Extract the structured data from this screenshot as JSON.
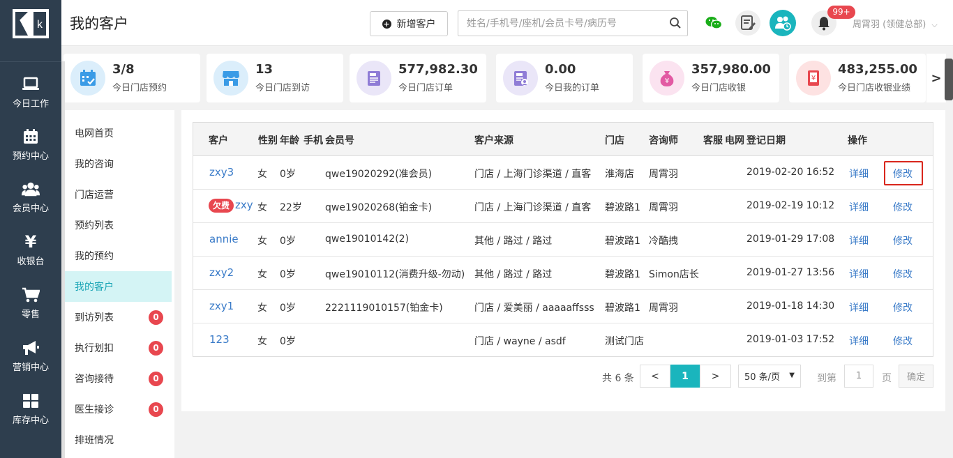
{
  "header": {
    "title": "我的客户",
    "add_button": "新增客户",
    "search_placeholder": "姓名/手机号/座机/会员卡号/病历号",
    "notification_badge": "99+",
    "user_label": "周霄羽 (领健总部)"
  },
  "sidebar": {
    "logo_letter": "k",
    "items": [
      {
        "label": "今日工作",
        "icon": "laptop-icon"
      },
      {
        "label": "预约中心",
        "icon": "calendar-icon"
      },
      {
        "label": "会员中心",
        "icon": "users-icon"
      },
      {
        "label": "收银台",
        "icon": "yen-icon"
      },
      {
        "label": "零售",
        "icon": "cart-icon"
      },
      {
        "label": "营销中心",
        "icon": "megaphone-icon"
      },
      {
        "label": "库存中心",
        "icon": "grid-icon"
      }
    ]
  },
  "stats": [
    {
      "value": "3/8",
      "label": "今日门店预约",
      "icon": "calendar-check-icon"
    },
    {
      "value": "13",
      "label": "今日门店到访",
      "icon": "store-icon"
    },
    {
      "value": "577,982.30",
      "label": "今日门店订单",
      "icon": "order-icon"
    },
    {
      "value": "0.00",
      "label": "今日我的订单",
      "icon": "my-order-icon"
    },
    {
      "value": "357,980.00",
      "label": "今日门店收银",
      "icon": "money-bag-icon"
    },
    {
      "value": "483,255.00",
      "label": "今日门店收银业绩",
      "icon": "receipt-icon"
    }
  ],
  "stats_next": ">",
  "submenu": [
    {
      "label": "电网首页"
    },
    {
      "label": "我的咨询"
    },
    {
      "label": "门店运营"
    },
    {
      "label": "预约列表"
    },
    {
      "label": "我的预约"
    },
    {
      "label": "我的客户"
    },
    {
      "label": "到访列表",
      "count": "0"
    },
    {
      "label": "执行划扣",
      "count": "0"
    },
    {
      "label": "咨询接待",
      "count": "0"
    },
    {
      "label": "医生接诊",
      "count": "0"
    },
    {
      "label": "排班情况"
    }
  ],
  "table": {
    "headers": {
      "customer": "客户",
      "gender": "性别",
      "age": "年龄",
      "phone": "手机",
      "member_no": "会员号",
      "source": "客户来源",
      "store": "门店",
      "consultant": "咨询师",
      "service": "客服",
      "network": "电网",
      "reg_date": "登记日期",
      "action": "操作"
    },
    "rows": [
      {
        "name": "zxy3",
        "tag": "",
        "gender": "女",
        "age": "0岁",
        "member": "qwe19020292(准会员)",
        "source": "门店 / 上海门诊渠道 / 直客",
        "store": "淮海店",
        "consultant": "周霄羽",
        "date": "2019-02-20 16:52",
        "detail": "详细",
        "edit": "修改"
      },
      {
        "name": "zxy",
        "tag": "欠费",
        "gender": "女",
        "age": "22岁",
        "member": "qwe19020268(铂金卡)",
        "source": "门店 / 上海门诊渠道 / 直客",
        "store": "碧波路1",
        "consultant": "周霄羽",
        "date": "2019-02-19 10:12",
        "detail": "详细",
        "edit": "修改"
      },
      {
        "name": "annie",
        "tag": "",
        "gender": "女",
        "age": "0岁",
        "member": "qwe19010142(2)",
        "source": "其他 / 路过 / 路过",
        "store": "碧波路1",
        "consultant": "冷酷拽",
        "date": "2019-01-29 17:08",
        "detail": "详细",
        "edit": "修改"
      },
      {
        "name": "zxy2",
        "tag": "",
        "gender": "女",
        "age": "0岁",
        "member": "qwe19010112(消费升级-勿动)",
        "source": "其他 / 路过 / 路过",
        "store": "碧波路1",
        "consultant": "Simon店长",
        "date": "2019-01-27 13:56",
        "detail": "详细",
        "edit": "修改"
      },
      {
        "name": "zxy1",
        "tag": "",
        "gender": "女",
        "age": "0岁",
        "member": "2221119010157(铂金卡)",
        "source": "门店 / 爱美丽 / aaaaaffsss",
        "store": "碧波路1",
        "consultant": "周霄羽",
        "date": "2019-01-18 14:30",
        "detail": "详细",
        "edit": "修改"
      },
      {
        "name": "123",
        "tag": "",
        "gender": "女",
        "age": "0岁",
        "member": "",
        "source": "门店 / wayne / asdf",
        "store": "测试门店",
        "consultant": "",
        "date": "2019-01-03 17:52",
        "detail": "详细",
        "edit": "修改"
      }
    ]
  },
  "pagination": {
    "total": "共 6 条",
    "prev": "<",
    "current": "1",
    "next": ">",
    "page_size": "50 条/页",
    "goto_prefix": "到第",
    "goto_value": "1",
    "goto_suffix": "页",
    "confirm": "确定"
  },
  "colors": {
    "sidebar_bg": "#2e3e4e",
    "accent": "#1ab5bd",
    "link": "#3a7bc8",
    "danger": "#e8474f",
    "highlight_box": "#d9261c"
  }
}
